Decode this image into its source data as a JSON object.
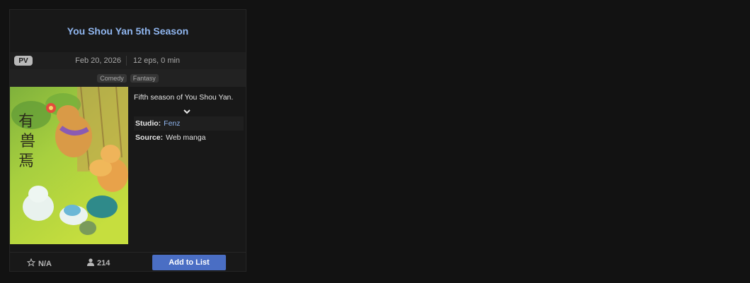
{
  "card": {
    "title": "You Shou Yan 5th Season",
    "pv_label": "PV",
    "date": "Feb 20, 2026",
    "episodes": "12 eps, 0 min",
    "genres": [
      "Comedy",
      "Fantasy"
    ],
    "synopsis": "Fifth season of You Shou Yan.",
    "studio_label": "Studio:",
    "studio": "Fenz",
    "source_label": "Source:",
    "source": "Web manga",
    "score": "N/A",
    "members": "214",
    "add_button": "Add to List"
  },
  "colors": {
    "background": "#121212",
    "title": "#90b6ef",
    "accent_button": "#4a6ec4"
  },
  "icons": [
    "star-icon",
    "user-icon",
    "chevron-down-icon"
  ]
}
